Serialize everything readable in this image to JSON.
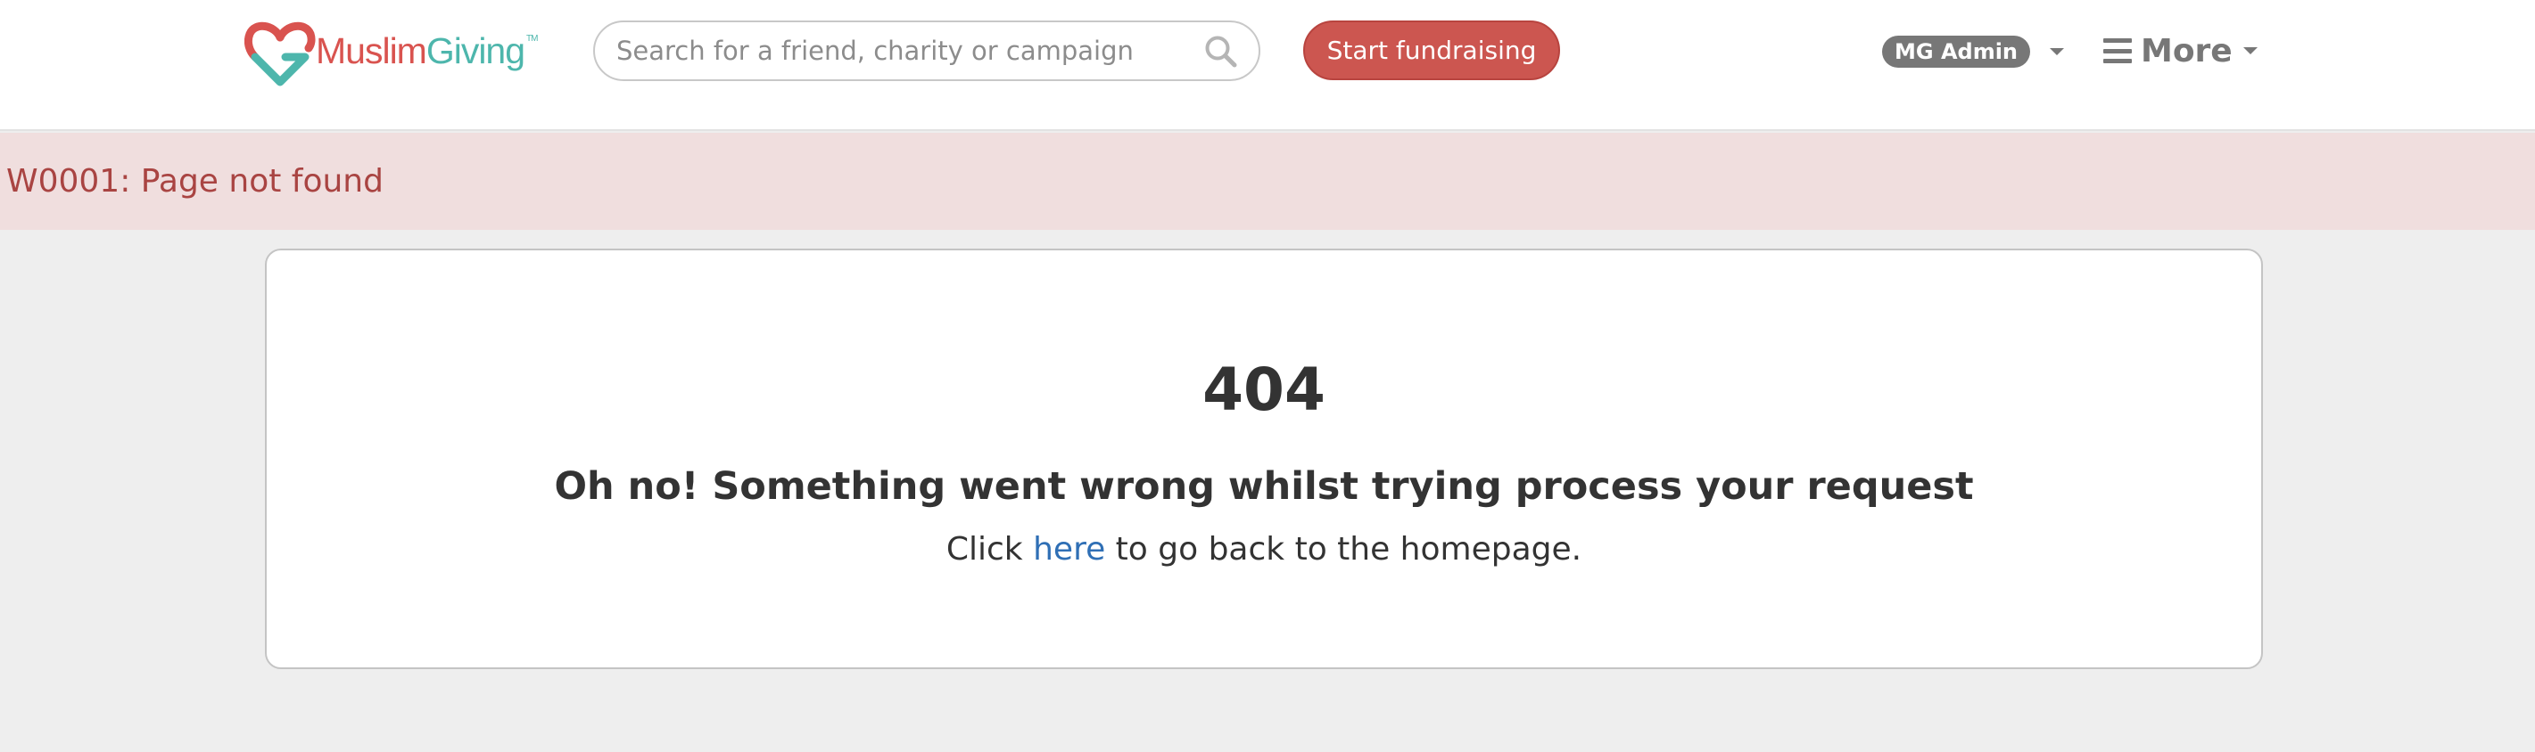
{
  "header": {
    "logo": {
      "brand_part1": "Muslim",
      "brand_part2": "Giving",
      "trademark": "TM",
      "icon": "heart-g-logo-icon",
      "colors": {
        "primary": "#d9534f",
        "secondary": "#4db6ac"
      }
    },
    "search": {
      "placeholder": "Search for a friend, charity or campaign",
      "value": "",
      "icon": "search-icon"
    },
    "start_button_label": "Start fundraising",
    "user_menu": {
      "label": "MG Admin",
      "icon": "chevron-down-icon"
    },
    "more_menu": {
      "label": "More",
      "icon": "hamburger-icon"
    }
  },
  "alert": {
    "message": "W0001: Page not found",
    "color": "#a94442",
    "background": "#f0dede"
  },
  "error_panel": {
    "code": "404",
    "title": "Oh no! Something went wrong whilst trying process your request",
    "message_prefix": "Click ",
    "link_text": "here",
    "message_suffix": " to go back to the homepage."
  },
  "colors": {
    "accent_button": "#cc5650",
    "link": "#2f6fb5",
    "page_background": "#eeeeee"
  }
}
